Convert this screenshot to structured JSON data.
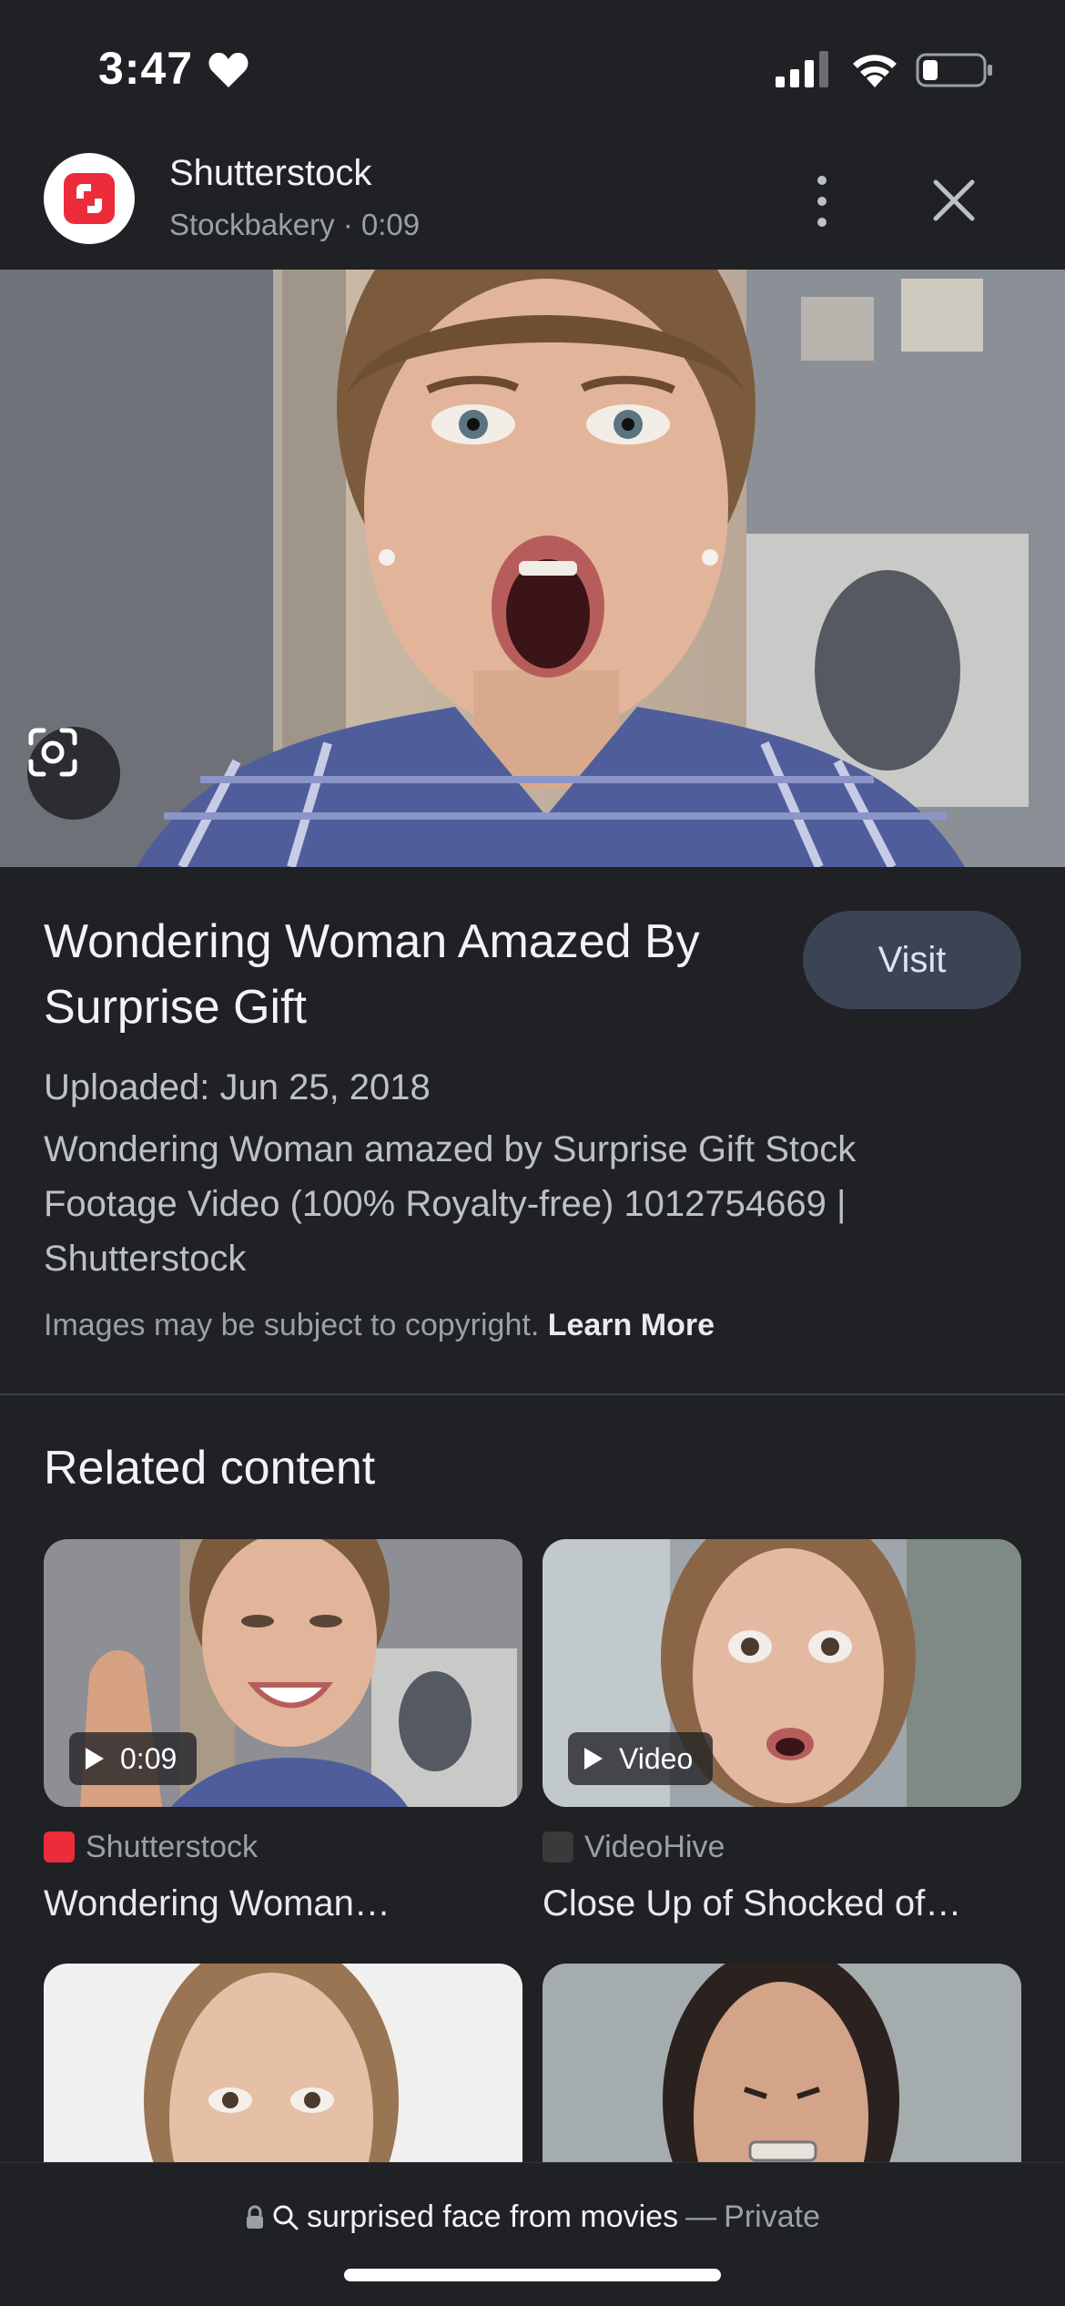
{
  "status_bar": {
    "time": "3:47",
    "icons": [
      "heart-icon",
      "signal-icon",
      "wifi-icon",
      "battery-icon"
    ]
  },
  "header": {
    "source_name": "Shutterstock",
    "subtitle": "Stockbakery · 0:09",
    "logo_color": "#ee2b3b"
  },
  "detail": {
    "title": "Wondering Woman Amazed By Surprise Gift",
    "visit_label": "Visit",
    "uploaded": "Uploaded: Jun 25, 2018",
    "description": "Wondering Woman amazed by Surprise Gift Stock Footage Video (100% Royalty-free) 1012754669 | Shutterstock",
    "copyright_text": "Images may be subject to copyright.",
    "learn_more": "Learn More"
  },
  "related": {
    "heading": "Related content",
    "items": [
      {
        "badge": "0:09",
        "source": "Shutterstock",
        "title": "Wondering Woman…"
      },
      {
        "badge": "Video",
        "source": "VideoHive",
        "title": "Close Up of Shocked of…"
      }
    ]
  },
  "address_bar": {
    "query": "surprised face from movies",
    "separator": "—",
    "mode": "Private"
  },
  "colors": {
    "background": "#202124",
    "visit_button": "#3c4354",
    "shutterstock_red": "#ee2b3b"
  }
}
